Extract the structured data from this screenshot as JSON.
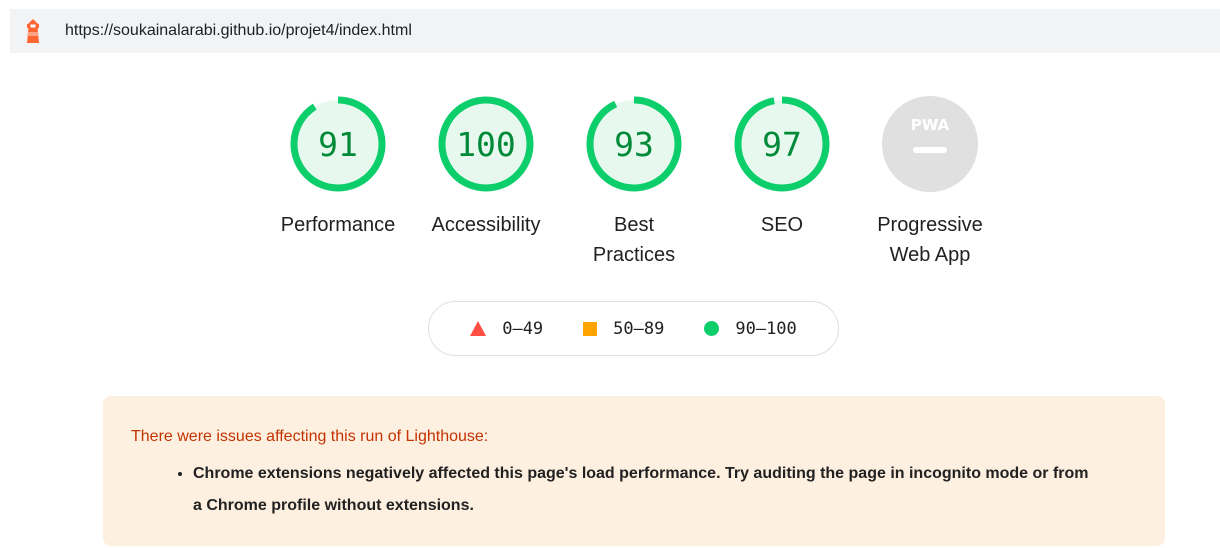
{
  "header": {
    "url": "https://soukainalarabi.github.io/projet4/index.html",
    "logo_icon": "lighthouse-icon"
  },
  "gauges": [
    {
      "id": "performance",
      "score": "91",
      "value": 91,
      "label": "Performance",
      "color": "#0cce6b"
    },
    {
      "id": "accessibility",
      "score": "100",
      "value": 100,
      "label": "Accessibility",
      "color": "#0cce6b"
    },
    {
      "id": "best-practices",
      "score": "93",
      "value": 93,
      "label_line1": "Best",
      "label_line2": "Practices",
      "color": "#0cce6b"
    },
    {
      "id": "seo",
      "score": "97",
      "value": 97,
      "label": "SEO",
      "color": "#0cce6b"
    },
    {
      "id": "pwa",
      "badge": "PWA",
      "label_line1": "Progressive",
      "label_line2": "Web App",
      "color": "#cccccc"
    }
  ],
  "legend": {
    "fail": {
      "range": "0–49",
      "color": "#ff4e42",
      "icon": "triangle-icon"
    },
    "average": {
      "range": "50–89",
      "color": "#ffa400",
      "icon": "square-icon"
    },
    "pass": {
      "range": "90–100",
      "color": "#0cce6b",
      "icon": "circle-icon"
    }
  },
  "warning": {
    "title": "There were issues affecting this run of Lighthouse:",
    "items": [
      "Chrome extensions negatively affected this page's load performance. Try auditing the page in incognito mode or from a Chrome profile without extensions."
    ]
  }
}
